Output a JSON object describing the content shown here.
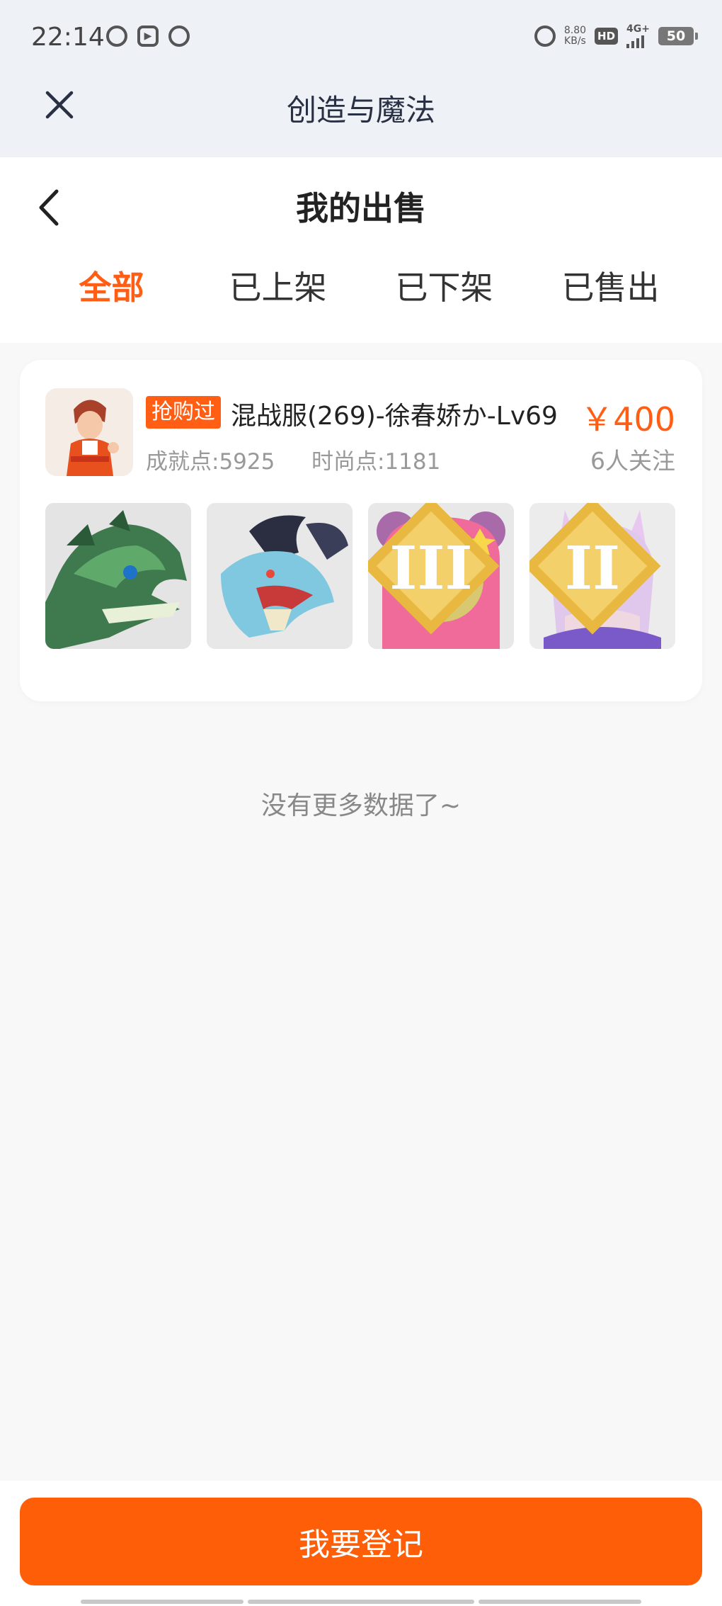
{
  "status_bar": {
    "time": "22:14",
    "speed_value": "8.80",
    "speed_unit": "KB/s",
    "hd": "HD",
    "network": "4G+",
    "battery": "50"
  },
  "app": {
    "title": "创造与魔法"
  },
  "page": {
    "title": "我的出售"
  },
  "tabs": [
    {
      "label": "全部",
      "active": true
    },
    {
      "label": "已上架",
      "active": false
    },
    {
      "label": "已下架",
      "active": false
    },
    {
      "label": "已售出",
      "active": false
    }
  ],
  "listing": {
    "badge": "抢购过",
    "name": "混战服(269)-徐春娇か-Lv69",
    "price": "￥400",
    "achievement": "成就点:5925",
    "fashion": "时尚点:1181",
    "followers": "6人关注",
    "thumbnails": [
      {
        "name": "green-dragon-mount",
        "rank": ""
      },
      {
        "name": "blue-dragon-mount",
        "rank": ""
      },
      {
        "name": "pink-bear-pet",
        "rank": "III"
      },
      {
        "name": "fox-spirit-pet",
        "rank": "II"
      }
    ]
  },
  "footer": {
    "no_more": "没有更多数据了~",
    "register_label": "我要登记"
  },
  "colors": {
    "accent": "#ff5e14",
    "header_bg": "#eef2f7",
    "page_bg": "#f8f8f8"
  }
}
